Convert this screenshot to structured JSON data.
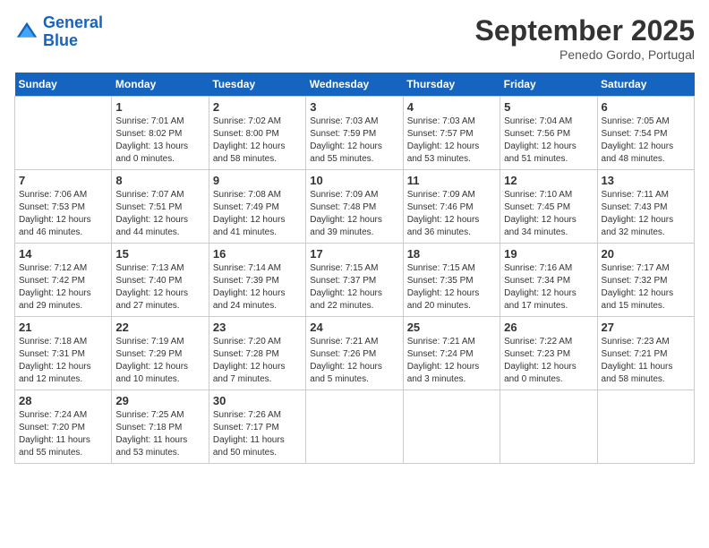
{
  "header": {
    "logo_line1": "General",
    "logo_line2": "Blue",
    "month": "September 2025",
    "location": "Penedo Gordo, Portugal"
  },
  "weekdays": [
    "Sunday",
    "Monday",
    "Tuesday",
    "Wednesday",
    "Thursday",
    "Friday",
    "Saturday"
  ],
  "weeks": [
    [
      {
        "day": "",
        "info": ""
      },
      {
        "day": "1",
        "info": "Sunrise: 7:01 AM\nSunset: 8:02 PM\nDaylight: 13 hours\nand 0 minutes."
      },
      {
        "day": "2",
        "info": "Sunrise: 7:02 AM\nSunset: 8:00 PM\nDaylight: 12 hours\nand 58 minutes."
      },
      {
        "day": "3",
        "info": "Sunrise: 7:03 AM\nSunset: 7:59 PM\nDaylight: 12 hours\nand 55 minutes."
      },
      {
        "day": "4",
        "info": "Sunrise: 7:03 AM\nSunset: 7:57 PM\nDaylight: 12 hours\nand 53 minutes."
      },
      {
        "day": "5",
        "info": "Sunrise: 7:04 AM\nSunset: 7:56 PM\nDaylight: 12 hours\nand 51 minutes."
      },
      {
        "day": "6",
        "info": "Sunrise: 7:05 AM\nSunset: 7:54 PM\nDaylight: 12 hours\nand 48 minutes."
      }
    ],
    [
      {
        "day": "7",
        "info": "Sunrise: 7:06 AM\nSunset: 7:53 PM\nDaylight: 12 hours\nand 46 minutes."
      },
      {
        "day": "8",
        "info": "Sunrise: 7:07 AM\nSunset: 7:51 PM\nDaylight: 12 hours\nand 44 minutes."
      },
      {
        "day": "9",
        "info": "Sunrise: 7:08 AM\nSunset: 7:49 PM\nDaylight: 12 hours\nand 41 minutes."
      },
      {
        "day": "10",
        "info": "Sunrise: 7:09 AM\nSunset: 7:48 PM\nDaylight: 12 hours\nand 39 minutes."
      },
      {
        "day": "11",
        "info": "Sunrise: 7:09 AM\nSunset: 7:46 PM\nDaylight: 12 hours\nand 36 minutes."
      },
      {
        "day": "12",
        "info": "Sunrise: 7:10 AM\nSunset: 7:45 PM\nDaylight: 12 hours\nand 34 minutes."
      },
      {
        "day": "13",
        "info": "Sunrise: 7:11 AM\nSunset: 7:43 PM\nDaylight: 12 hours\nand 32 minutes."
      }
    ],
    [
      {
        "day": "14",
        "info": "Sunrise: 7:12 AM\nSunset: 7:42 PM\nDaylight: 12 hours\nand 29 minutes."
      },
      {
        "day": "15",
        "info": "Sunrise: 7:13 AM\nSunset: 7:40 PM\nDaylight: 12 hours\nand 27 minutes."
      },
      {
        "day": "16",
        "info": "Sunrise: 7:14 AM\nSunset: 7:39 PM\nDaylight: 12 hours\nand 24 minutes."
      },
      {
        "day": "17",
        "info": "Sunrise: 7:15 AM\nSunset: 7:37 PM\nDaylight: 12 hours\nand 22 minutes."
      },
      {
        "day": "18",
        "info": "Sunrise: 7:15 AM\nSunset: 7:35 PM\nDaylight: 12 hours\nand 20 minutes."
      },
      {
        "day": "19",
        "info": "Sunrise: 7:16 AM\nSunset: 7:34 PM\nDaylight: 12 hours\nand 17 minutes."
      },
      {
        "day": "20",
        "info": "Sunrise: 7:17 AM\nSunset: 7:32 PM\nDaylight: 12 hours\nand 15 minutes."
      }
    ],
    [
      {
        "day": "21",
        "info": "Sunrise: 7:18 AM\nSunset: 7:31 PM\nDaylight: 12 hours\nand 12 minutes."
      },
      {
        "day": "22",
        "info": "Sunrise: 7:19 AM\nSunset: 7:29 PM\nDaylight: 12 hours\nand 10 minutes."
      },
      {
        "day": "23",
        "info": "Sunrise: 7:20 AM\nSunset: 7:28 PM\nDaylight: 12 hours\nand 7 minutes."
      },
      {
        "day": "24",
        "info": "Sunrise: 7:21 AM\nSunset: 7:26 PM\nDaylight: 12 hours\nand 5 minutes."
      },
      {
        "day": "25",
        "info": "Sunrise: 7:21 AM\nSunset: 7:24 PM\nDaylight: 12 hours\nand 3 minutes."
      },
      {
        "day": "26",
        "info": "Sunrise: 7:22 AM\nSunset: 7:23 PM\nDaylight: 12 hours\nand 0 minutes."
      },
      {
        "day": "27",
        "info": "Sunrise: 7:23 AM\nSunset: 7:21 PM\nDaylight: 11 hours\nand 58 minutes."
      }
    ],
    [
      {
        "day": "28",
        "info": "Sunrise: 7:24 AM\nSunset: 7:20 PM\nDaylight: 11 hours\nand 55 minutes."
      },
      {
        "day": "29",
        "info": "Sunrise: 7:25 AM\nSunset: 7:18 PM\nDaylight: 11 hours\nand 53 minutes."
      },
      {
        "day": "30",
        "info": "Sunrise: 7:26 AM\nSunset: 7:17 PM\nDaylight: 11 hours\nand 50 minutes."
      },
      {
        "day": "",
        "info": ""
      },
      {
        "day": "",
        "info": ""
      },
      {
        "day": "",
        "info": ""
      },
      {
        "day": "",
        "info": ""
      }
    ]
  ]
}
